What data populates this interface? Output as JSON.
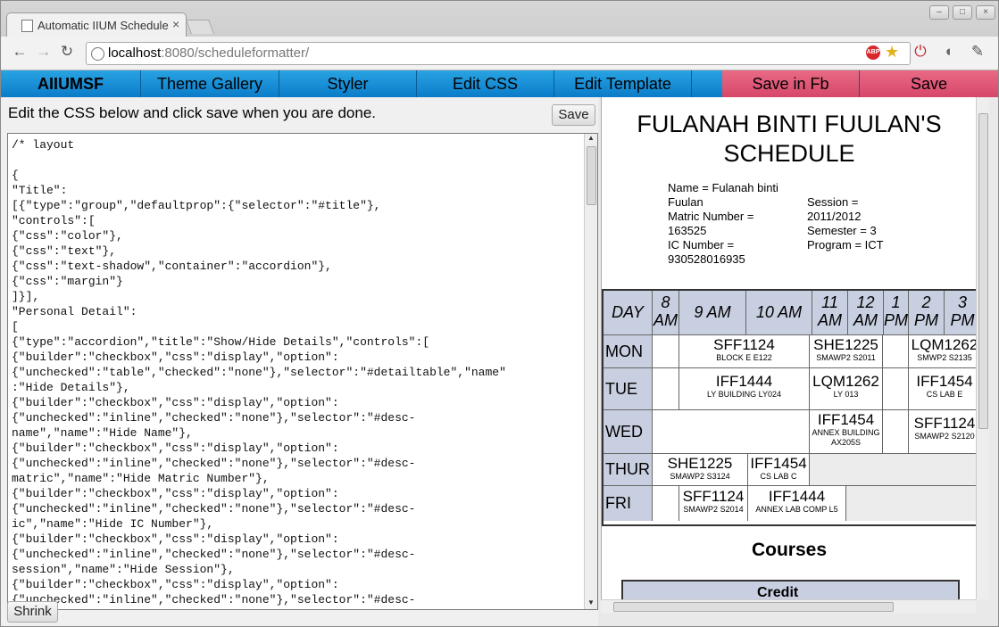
{
  "browser": {
    "tab_title": "Automatic IIUM Schedule",
    "close_glyph": "×",
    "url_host": "localhost",
    "url_path": ":8080/scheduleformatter/",
    "abp_label": "ABP"
  },
  "menu": {
    "brand": "AIIUMSF",
    "items": [
      "Theme Gallery",
      "Styler",
      "Edit CSS",
      "Edit Template"
    ],
    "save_fb": "Save in Fb",
    "save": "Save",
    "colors": {
      "bar": "#1a8fd6",
      "fb": "#dc5373"
    }
  },
  "editor": {
    "instructions": "Edit the CSS below and click save when you are done.",
    "save_label": "Save",
    "shrink_label": "Shrink",
    "content": "/* layout\n\n{\n\"Title\":\n[{\"type\":\"group\",\"defaultprop\":{\"selector\":\"#title\"},\n\"controls\":[\n{\"css\":\"color\"},\n{\"css\":\"text\"},\n{\"css\":\"text-shadow\",\"container\":\"accordion\"},\n{\"css\":\"margin\"}\n]}],\n\"Personal Detail\":\n[\n{\"type\":\"accordion\",\"title\":\"Show/Hide Details\",\"controls\":[\n{\"builder\":\"checkbox\",\"css\":\"display\",\"option\":\n{\"unchecked\":\"table\",\"checked\":\"none\"},\"selector\":\"#detailtable\",\"name\"\n:\"Hide Details\"},\n{\"builder\":\"checkbox\",\"css\":\"display\",\"option\":\n{\"unchecked\":\"inline\",\"checked\":\"none\"},\"selector\":\"#desc-\nname\",\"name\":\"Hide Name\"},\n{\"builder\":\"checkbox\",\"css\":\"display\",\"option\":\n{\"unchecked\":\"inline\",\"checked\":\"none\"},\"selector\":\"#desc-\nmatric\",\"name\":\"Hide Matric Number\"},\n{\"builder\":\"checkbox\",\"css\":\"display\",\"option\":\n{\"unchecked\":\"inline\",\"checked\":\"none\"},\"selector\":\"#desc-\nic\",\"name\":\"Hide IC Number\"},\n{\"builder\":\"checkbox\",\"css\":\"display\",\"option\":\n{\"unchecked\":\"inline\",\"checked\":\"none\"},\"selector\":\"#desc-\nsession\",\"name\":\"Hide Session\"},\n{\"builder\":\"checkbox\",\"css\":\"display\",\"option\":\n{\"unchecked\":\"inline\",\"checked\":\"none\"},\"selector\":\"#desc-"
  },
  "schedule": {
    "title": "FULANAH BINTI FUULAN'S SCHEDULE",
    "details_left": [
      "Name = Fulanah binti",
      "Fuulan",
      "Matric Number =",
      "163525",
      "IC Number =",
      "930528016935"
    ],
    "details_right": [
      "Session =",
      "2011/2012",
      "Semester = 3",
      "Program = ICT"
    ],
    "header": [
      "DAY",
      "8 AM",
      "9 AM",
      "10 AM",
      "11 AM",
      "12 AM",
      "1 PM",
      "2 PM",
      "3 PM"
    ],
    "days": [
      {
        "name": "MON",
        "slots": [
          {
            "code": "SFF1124",
            "room": "BLOCK E E122"
          },
          {
            "code": "SHE1225",
            "room": "SMAWP2 S2011"
          },
          {
            "code": "LQM1262",
            "room": "SMWP2 S2135"
          }
        ]
      },
      {
        "name": "TUE",
        "slots": [
          {
            "code": "IFF1444",
            "room": "LY BUILDING LY024"
          },
          {
            "code": "LQM1262",
            "room": "LY 013"
          },
          {
            "code": "IFF1454",
            "room": "CS LAB E"
          }
        ]
      },
      {
        "name": "WED",
        "slots": [
          {
            "code": "IFF1454",
            "room": "ANNEX BUILDING AX205S"
          },
          {
            "code": "SFF1124",
            "room": "SMAWP2 S2120"
          }
        ]
      },
      {
        "name": "THUR",
        "slots": [
          {
            "code": "SHE1225",
            "room": "SMAWP2 S3124"
          },
          {
            "code": "IFF1454",
            "room": "CS LAB C"
          }
        ]
      },
      {
        "name": "FRI",
        "slots": [
          {
            "code": "SFF1124",
            "room": "SMAWP2 S2014"
          },
          {
            "code": "IFF1444",
            "room": "ANNEX LAB COMP L5"
          }
        ]
      }
    ],
    "courses_heading": "Courses",
    "courses_col_credit": "Credit",
    "colors": {
      "header_bg": "#c8cfe0"
    }
  }
}
